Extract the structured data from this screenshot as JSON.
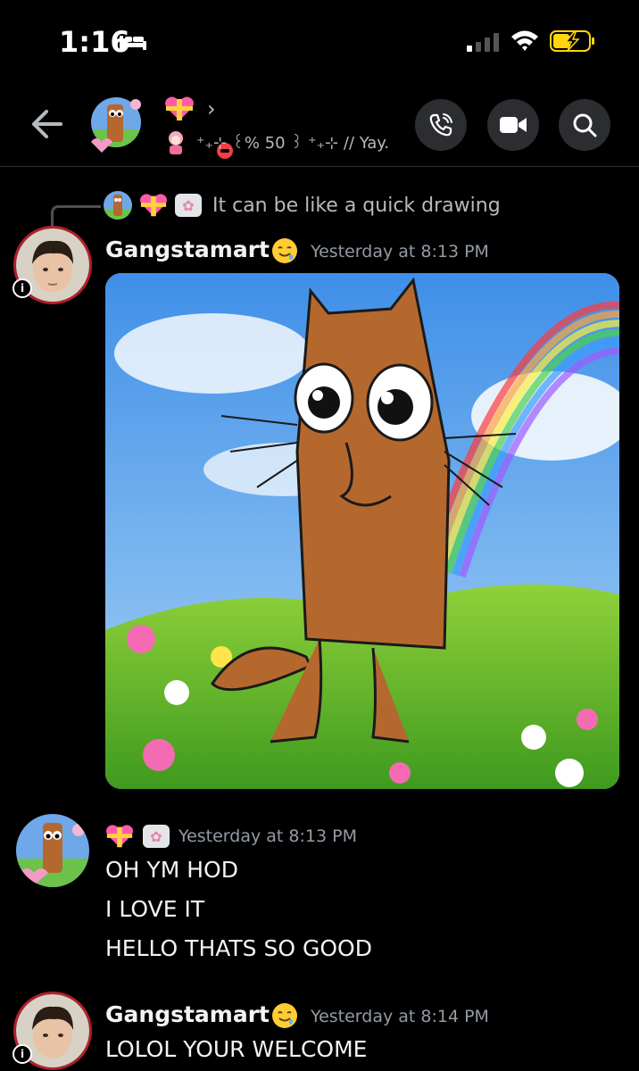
{
  "status_bar": {
    "time": "1:16",
    "icons": [
      "bed-icon",
      "cellular-signal-icon",
      "wifi-icon",
      "battery-charging-icon"
    ]
  },
  "header": {
    "back_icon": "arrow-left-icon",
    "title_emoji": "heart-with-ribbon-emoji",
    "chevron": "›",
    "status_text": "⁺₊⊹ ꒰% 50 ꒱ ⁺₊⊹ // Yay.",
    "actions": [
      "call-icon",
      "video-icon",
      "search-icon"
    ]
  },
  "reply": {
    "tag_glyph": "✿",
    "text": "It can be like a quick drawing"
  },
  "messages": [
    {
      "username": "Gangstamart",
      "timestamp": "Yesterday at 8:13 PM",
      "badge": "i",
      "attachment": "image-attachment"
    },
    {
      "username_tag": "✿",
      "timestamp": "Yesterday at 8:13 PM",
      "lines": [
        "OH YM HOD",
        "I LOVE IT",
        "HELLO THATS SO GOOD"
      ]
    },
    {
      "username": "Gangstamart",
      "timestamp": "Yesterday at 8:14 PM",
      "badge": "i",
      "lines": [
        "LOLOL YOUR WELCOME"
      ]
    }
  ],
  "colors": {
    "background": "#000000",
    "text": "#f2f3f5",
    "muted": "#949ba4",
    "button_bg": "#2b2d31",
    "dnd_red": "#f23f43",
    "ring_red": "#b01f2c"
  }
}
